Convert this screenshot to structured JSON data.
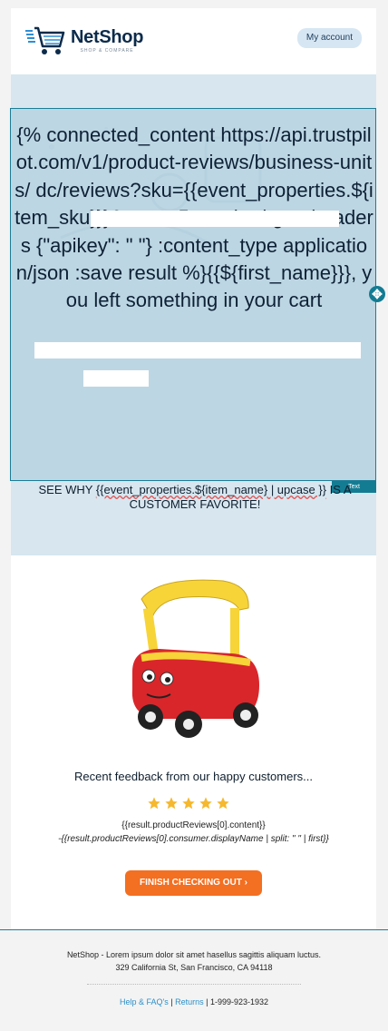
{
  "header": {
    "logo_name": "NetShop",
    "logo_tagline": "SHOP & COMPARE",
    "account_button": "My account"
  },
  "hero": {
    "liquid_template": "{% connected_content https://api.trustpilot.com/v1/product-reviews/business-units/                      dc/reviews?sku={{event_properties.${item_sku}}}&stars=5 :method get :headers {\"apikey\": \"                                \"} :content_type application/json :save result %}{{${first_name}}}, you left something in your cart",
    "subhead_prefix": "SEE WHY ",
    "subhead_variable": "{{event_properties.${item_name} | upcase }}",
    "subhead_suffix": " IS A CUSTOMER FAVORITE!",
    "editor_tag": "Text",
    "handle_icon": "move-icon"
  },
  "product": {
    "image_alt": "Red and yellow ride-on toy car",
    "feedback_title": "Recent feedback from our happy customers...",
    "rating": 5,
    "review_content": "{{result.productReviews[0].content}}",
    "review_author": "-{{result.productReviews[0].consumer.displayName | split: \" \" | first}}",
    "cta_label": "FINISH CHECKING OUT ›"
  },
  "colors": {
    "accent": "#f36f21",
    "hero_bg": "#d7e6ef",
    "editor_teal": "#137c93",
    "star": "#f5b82e"
  },
  "footer": {
    "info_line1": "NetShop - Lorem ipsum dolor sit amet hasellus sagittis aliquam luctus.",
    "info_line2": "329 California St, San Francisco, CA 94118",
    "link_help": "Help & FAQ's",
    "link_returns": "Returns",
    "phone": "1-999-923-1932"
  }
}
